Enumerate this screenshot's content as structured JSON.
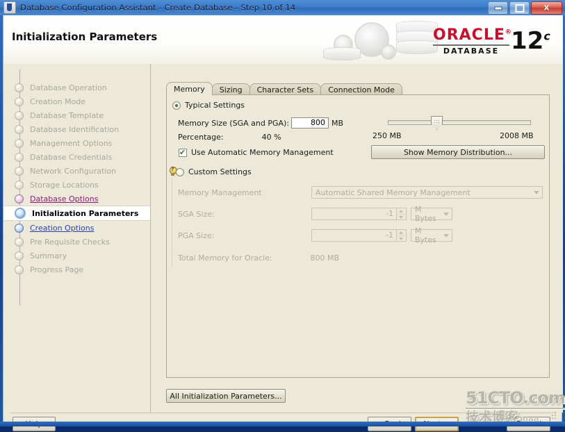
{
  "window": {
    "title": "Database Configuration Assistant - Create Database - Step 10 of 14",
    "app_icon": "java-coffee-cup-icon",
    "buttons": {
      "minimize": "minimize-icon",
      "maximize": "maximize-icon",
      "close": "X"
    }
  },
  "banner": {
    "page_title": "Initialization Parameters",
    "logo_word": "ORACLE",
    "logo_reg": "®",
    "logo_sub": "DATABASE",
    "version": "12",
    "version_sup": "c"
  },
  "sidebar": {
    "items": [
      {
        "label": "Database Operation",
        "state": "completed"
      },
      {
        "label": "Creation Mode",
        "state": "completed"
      },
      {
        "label": "Database Template",
        "state": "completed"
      },
      {
        "label": "Database Identification",
        "state": "completed"
      },
      {
        "label": "Management Options",
        "state": "completed"
      },
      {
        "label": "Database Credentials",
        "state": "completed"
      },
      {
        "label": "Network Configuration",
        "state": "completed"
      },
      {
        "label": "Storage Locations",
        "state": "completed"
      },
      {
        "label": "Database Options",
        "state": "visited"
      },
      {
        "label": "Initialization Parameters",
        "state": "current"
      },
      {
        "label": "Creation Options",
        "state": "next"
      },
      {
        "label": "Pre Requisite Checks",
        "state": "pending"
      },
      {
        "label": "Summary",
        "state": "pending"
      },
      {
        "label": "Progress Page",
        "state": "pending"
      }
    ]
  },
  "main": {
    "tabs": [
      {
        "label": "Memory",
        "active": true
      },
      {
        "label": "Sizing",
        "active": false
      },
      {
        "label": "Character Sets",
        "active": false
      },
      {
        "label": "Connection Mode",
        "active": false
      }
    ],
    "typical": {
      "radio_label": "Typical Settings",
      "selected": true,
      "memory_size_label": "Memory Size (SGA and PGA):",
      "memory_size_value": "800",
      "memory_size_unit": "MB",
      "percentage_label": "Percentage:",
      "percentage_value": "40 %",
      "amm_checkbox_label": "Use Automatic Memory Management",
      "amm_checked": true,
      "slider_min_label": "250 MB",
      "slider_max_label": "2008 MB",
      "slider_value": 800,
      "slider_min": 250,
      "slider_max": 2008,
      "show_distribution_button": "Show Memory Distribution..."
    },
    "custom": {
      "radio_label": "Custom Settings",
      "selected": false,
      "hint_icon": "lightbulb-hint-icon",
      "memory_management_label": "Memory Management",
      "memory_management_value": "Automatic Shared Memory Management",
      "sga_label": "SGA Size:",
      "sga_value": "-1",
      "sga_unit": "M Bytes",
      "pga_label": "PGA Size:",
      "pga_value": "-1",
      "pga_unit": "M Bytes",
      "total_label": "Total Memory for Oracle:",
      "total_value": "800 MB"
    },
    "all_params_button": "All Initialization Parameters..."
  },
  "footer": {
    "help_button": "Help",
    "back_button": "< Back",
    "next_button": "Next >",
    "cancel_button": "Cancel"
  },
  "watermark": {
    "line1": "51CTO.com",
    "line2": "技术博客",
    "line3": "Blog"
  }
}
